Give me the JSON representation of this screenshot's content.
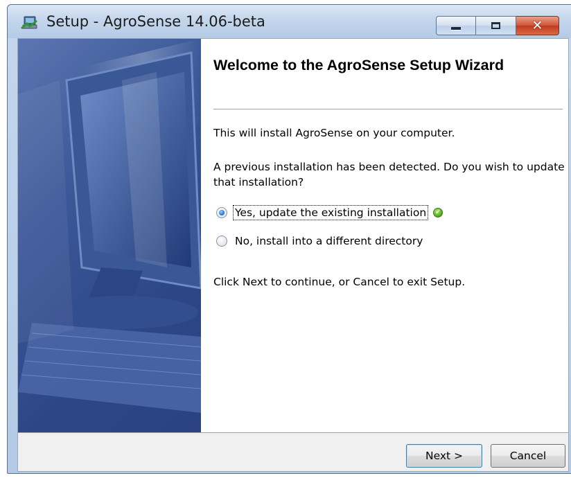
{
  "window": {
    "title": "Setup - AgroSense 14.06-beta",
    "controls": {
      "minimize_icon": "minimize-icon",
      "maximize_icon": "maximize-icon",
      "close_icon": "close-icon",
      "close_glyph": "✕"
    }
  },
  "wizard": {
    "heading": "Welcome to the AgroSense Setup Wizard",
    "intro": "This will install AgroSense on your computer.",
    "question": "A previous installation has been detected. Do you wish to update that installation?",
    "options": [
      {
        "label": "Yes, update the existing installation",
        "checked": true
      },
      {
        "label": "No, install into a different directory",
        "checked": false
      }
    ],
    "instruction": "Click Next to continue, or Cancel to exit Setup."
  },
  "buttons": {
    "next": "Next >",
    "cancel": "Cancel"
  },
  "colors": {
    "side_image_blue": "#3c5899",
    "title_bar": "#c3d6ec",
    "close_red": "#c03b1f",
    "radio_selected": "#2d7fd6",
    "ok_green": "#5fb52a"
  }
}
